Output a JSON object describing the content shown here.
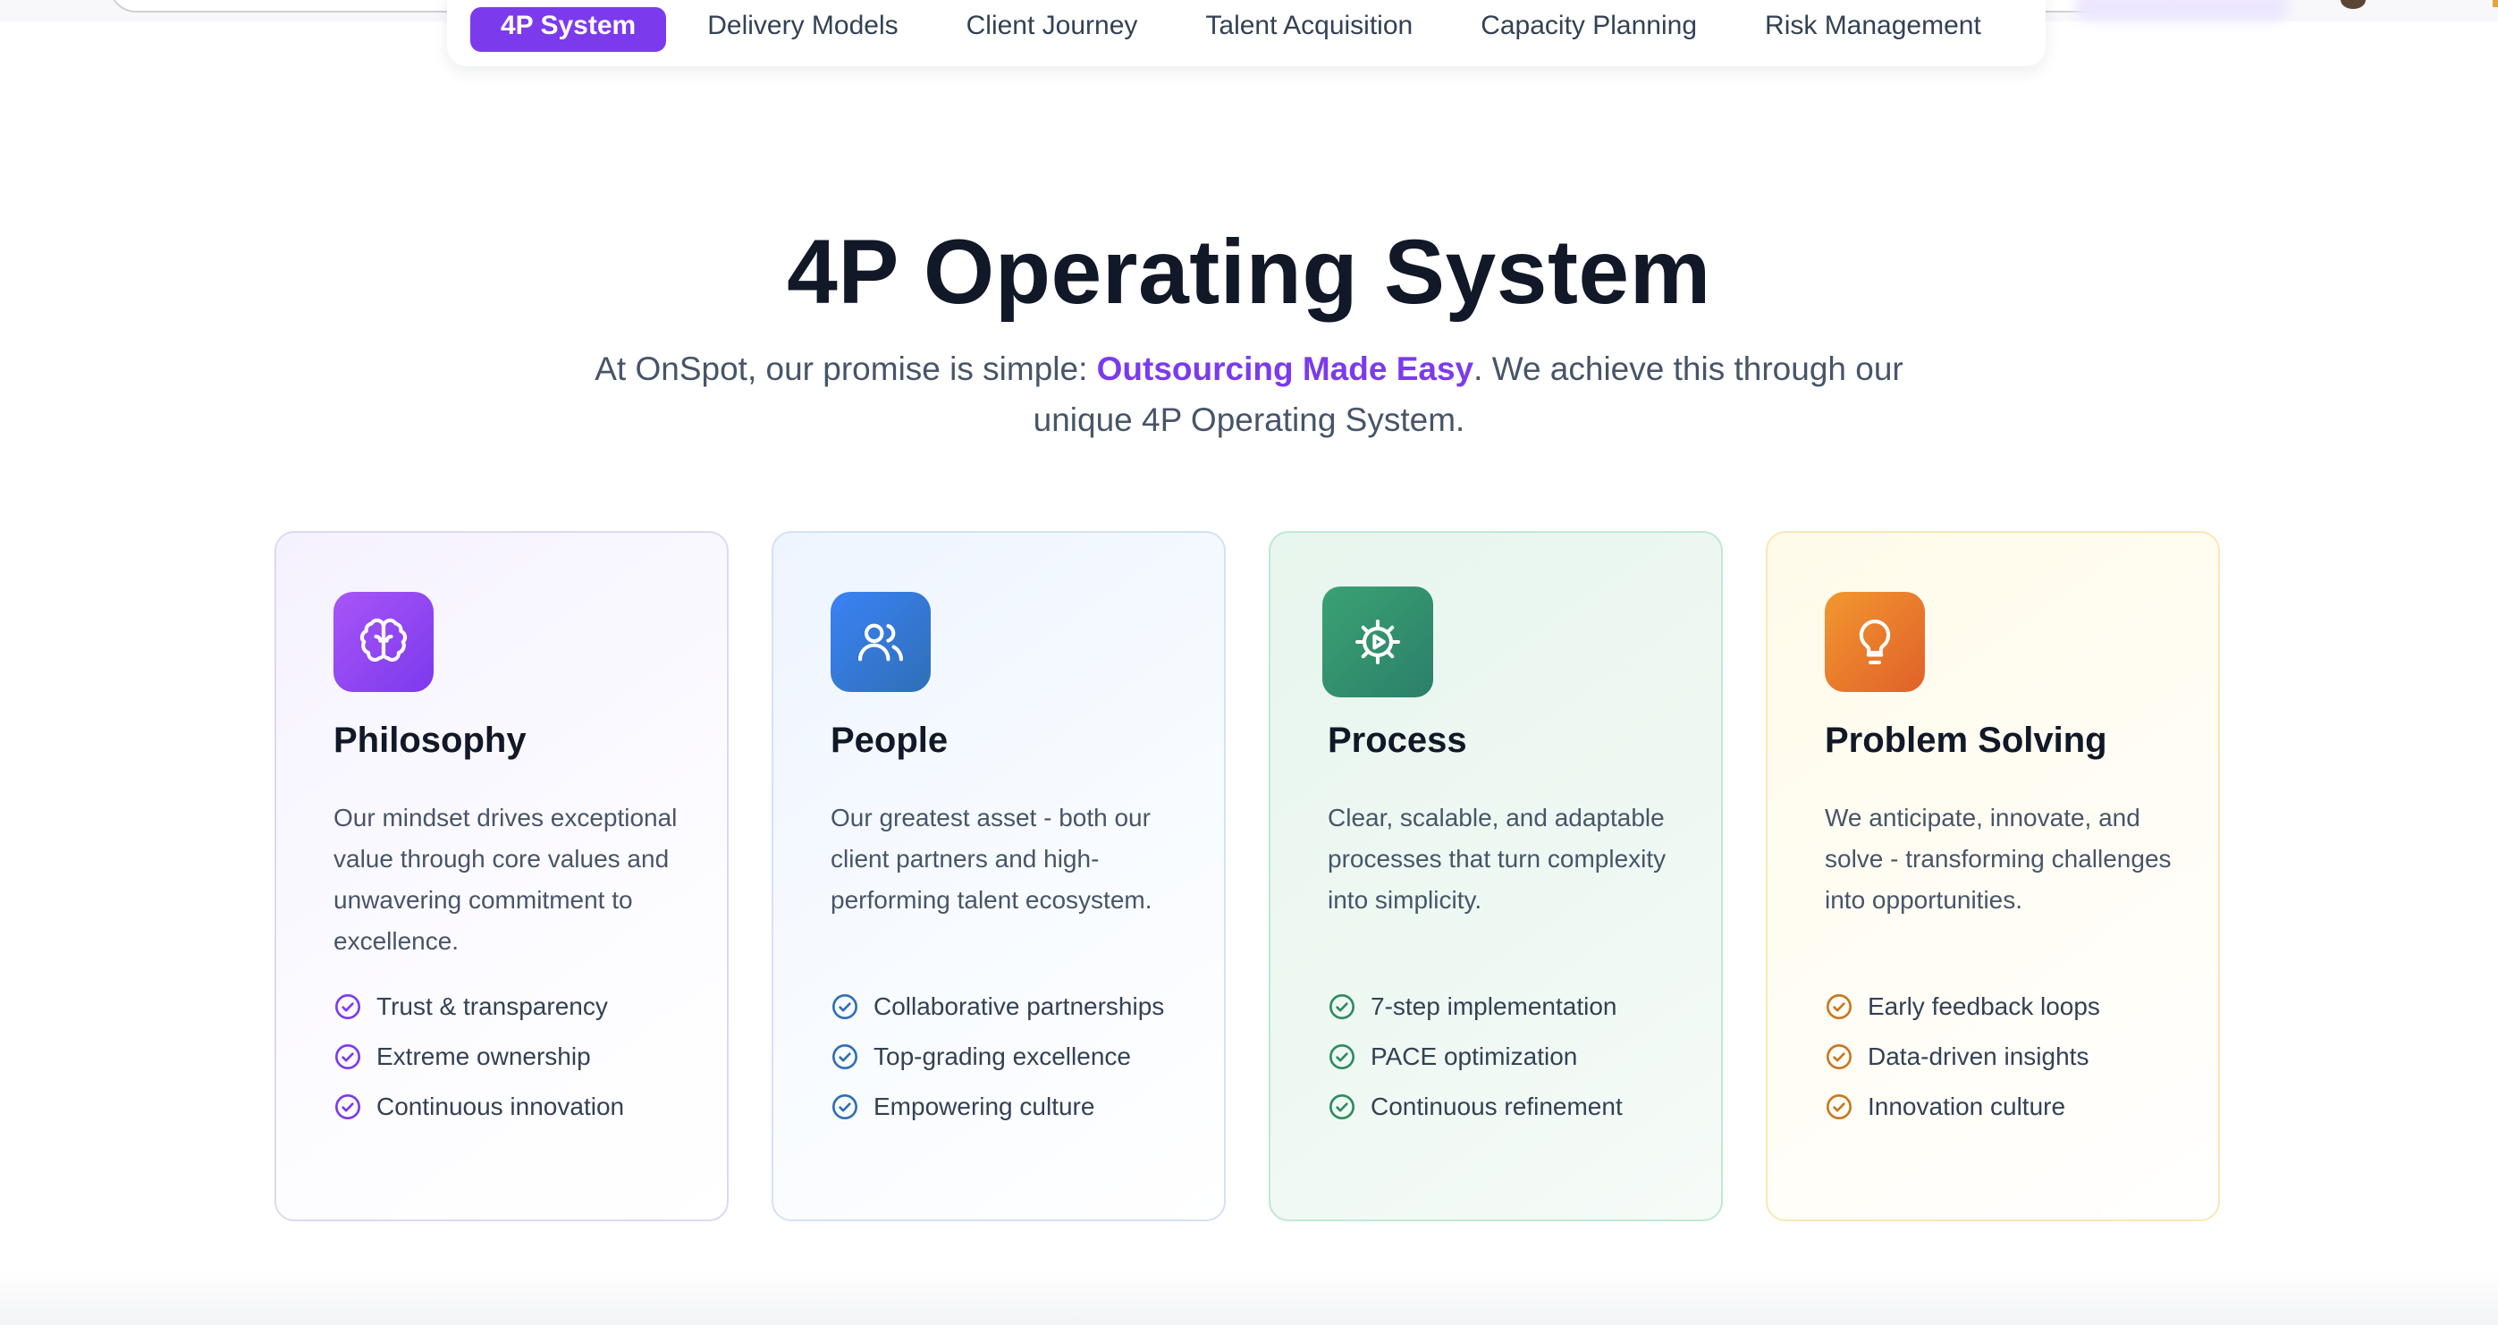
{
  "browser": {
    "url_value": ""
  },
  "nav": {
    "tabs": [
      {
        "label": "4P System",
        "active": true
      },
      {
        "label": "Delivery Models",
        "active": false
      },
      {
        "label": "Client Journey",
        "active": false
      },
      {
        "label": "Talent Acquisition",
        "active": false
      },
      {
        "label": "Capacity Planning",
        "active": false
      },
      {
        "label": "Risk Management",
        "active": false
      }
    ]
  },
  "hero": {
    "title": "4P Operating System",
    "sub_before": "At OnSpot, our promise is simple: ",
    "sub_highlight": "Outsourcing Made Easy",
    "sub_after": ". We achieve this through our unique 4P Operating System."
  },
  "cards": [
    {
      "icon": "brain-icon",
      "title": "Philosophy",
      "description": "Our mindset drives exceptional value through core values and unwavering commitment to excellence.",
      "items": [
        "Trust & transparency",
        "Extreme ownership",
        "Continuous innovation"
      ],
      "accent": "#7c3aed"
    },
    {
      "icon": "users-icon",
      "title": "People",
      "description": "Our greatest asset - both our client partners and high-performing talent ecosystem.",
      "items": [
        "Collaborative partnerships",
        "Top-grading excellence",
        "Empowering culture"
      ],
      "accent": "#2f6fb6"
    },
    {
      "icon": "gear-play-icon",
      "title": "Process",
      "description": "Clear, scalable, and adaptable processes that turn complexity into simplicity.",
      "items": [
        "7-step implementation",
        "PACE optimization",
        "Continuous refinement"
      ],
      "accent": "#2f8a60"
    },
    {
      "icon": "lightbulb-icon",
      "title": "Problem Solving",
      "description": "We anticipate, innovate, and solve - transforming challenges into opportunities.",
      "items": [
        "Early feedback loops",
        "Data-driven insights",
        "Innovation culture"
      ],
      "accent": "#c9761d"
    }
  ]
}
